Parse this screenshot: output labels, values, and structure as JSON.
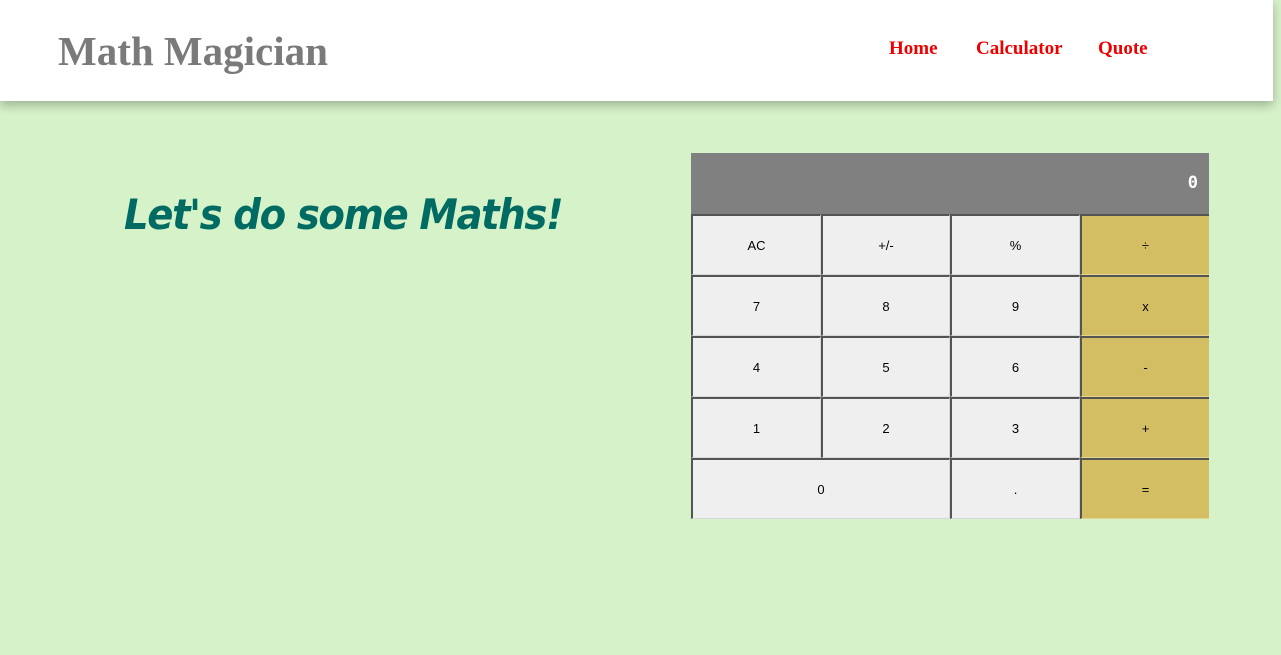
{
  "header": {
    "brand": "Math Magician",
    "nav": {
      "home": "Home",
      "calculator": "Calculator",
      "quote": "Quote"
    }
  },
  "main": {
    "headline": "Let's do some Maths!"
  },
  "calculator": {
    "display": "0",
    "keys": {
      "ac": "AC",
      "sign": "+/-",
      "percent": "%",
      "divide": "÷",
      "seven": "7",
      "eight": "8",
      "nine": "9",
      "multiply": "x",
      "four": "4",
      "five": "5",
      "six": "6",
      "subtract": "-",
      "one": "1",
      "two": "2",
      "three": "3",
      "add": "+",
      "zero": "0",
      "decimal": ".",
      "equals": "="
    }
  },
  "colors": {
    "page_background": "#d6f2c9",
    "brand_text": "#7a7a7a",
    "nav_link": "#ee0000",
    "headline": "#006b63",
    "display_background": "#808080",
    "key_background": "#efefef",
    "operator_key": "#d4be63"
  }
}
